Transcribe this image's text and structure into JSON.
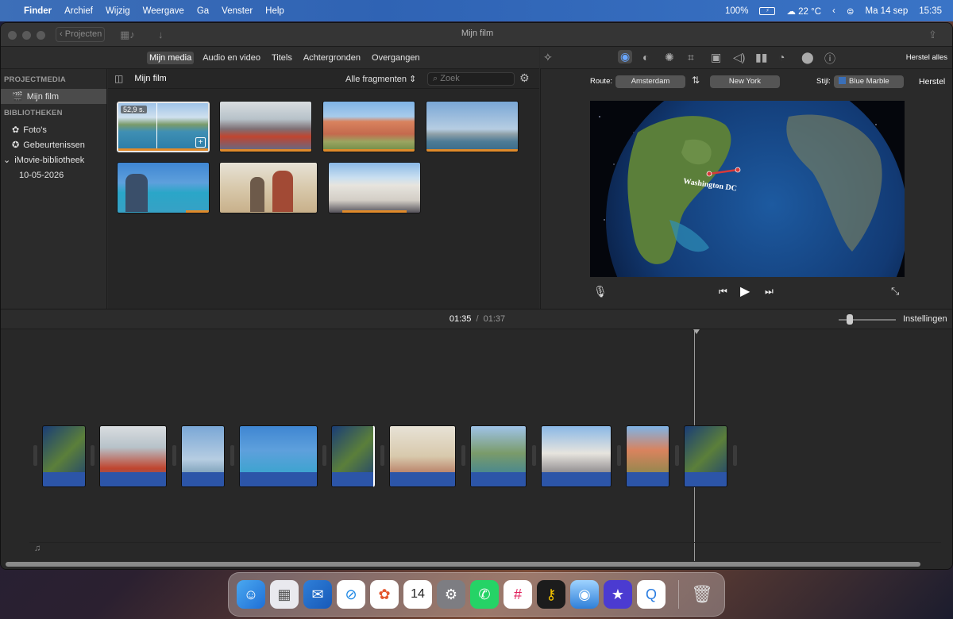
{
  "menubar": {
    "app": "Finder",
    "items": [
      "Archief",
      "Wijzig",
      "Weergave",
      "Ga",
      "Venster",
      "Help"
    ],
    "battery": "100%",
    "weather": "22 °C",
    "date": "Ma 14 sep",
    "time": "15:35"
  },
  "window": {
    "title": "Mijn film",
    "back_label": "Projecten"
  },
  "media_tabs": [
    "Mijn media",
    "Audio en video",
    "Titels",
    "Achtergronden",
    "Overgangen"
  ],
  "sidebar": {
    "project_header": "PROJECTMEDIA",
    "project_item": "Mijn film",
    "libraries_header": "BIBLIOTHEKEN",
    "photos": "Foto's",
    "events": "Gebeurtenissen",
    "library": "iMovie-bibliotheek",
    "date_item": "10-05-2026"
  },
  "browser": {
    "title": "Mijn film",
    "filter": "Alle fragmenten",
    "search_placeholder": "Zoek",
    "first_clip_duration": "52,9 s."
  },
  "viewer": {
    "reset_all": "Herstel alles",
    "route_label": "Route:",
    "from": "Amsterdam",
    "to": "New York",
    "style_label": "Stijl:",
    "style_value": "Blue Marble",
    "reset": "Herstel",
    "map_label": "Washington DC"
  },
  "timeline": {
    "current": "01:35",
    "separator": "/",
    "total": "01:37",
    "settings": "Instellingen"
  },
  "colors": {
    "menubar": "#3a6fc0",
    "clip_bar": "#e08a2a",
    "route_line": "#d63a3a",
    "timeline_lower": "#2c55a8"
  }
}
